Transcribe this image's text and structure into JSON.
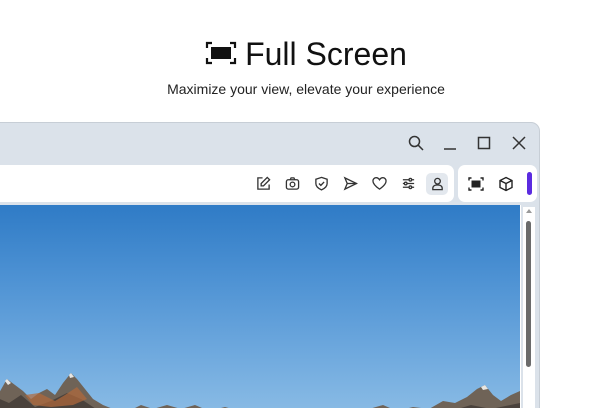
{
  "hero": {
    "icon": "fullscreen-icon",
    "title": "Full Screen",
    "subtitle": "Maximize your view, elevate your experience"
  },
  "titlebar": {
    "icons": [
      "search-icon",
      "minimize-icon",
      "maximize-icon",
      "close-icon"
    ]
  },
  "toolbar": {
    "icons": [
      "edit-icon",
      "camera-icon",
      "shield-check-icon",
      "send-icon",
      "heart-icon",
      "sliders-icon",
      "profile-icon"
    ],
    "active": "profile-icon"
  },
  "sidepanel": {
    "icons": [
      "fullscreen-icon",
      "cube-icon"
    ],
    "accent_color": "#5b2be0"
  },
  "content": {
    "image": "mountain-landscape-photo"
  },
  "colors": {
    "window_bg": "#dbe2ea",
    "accent": "#5b2be0"
  }
}
